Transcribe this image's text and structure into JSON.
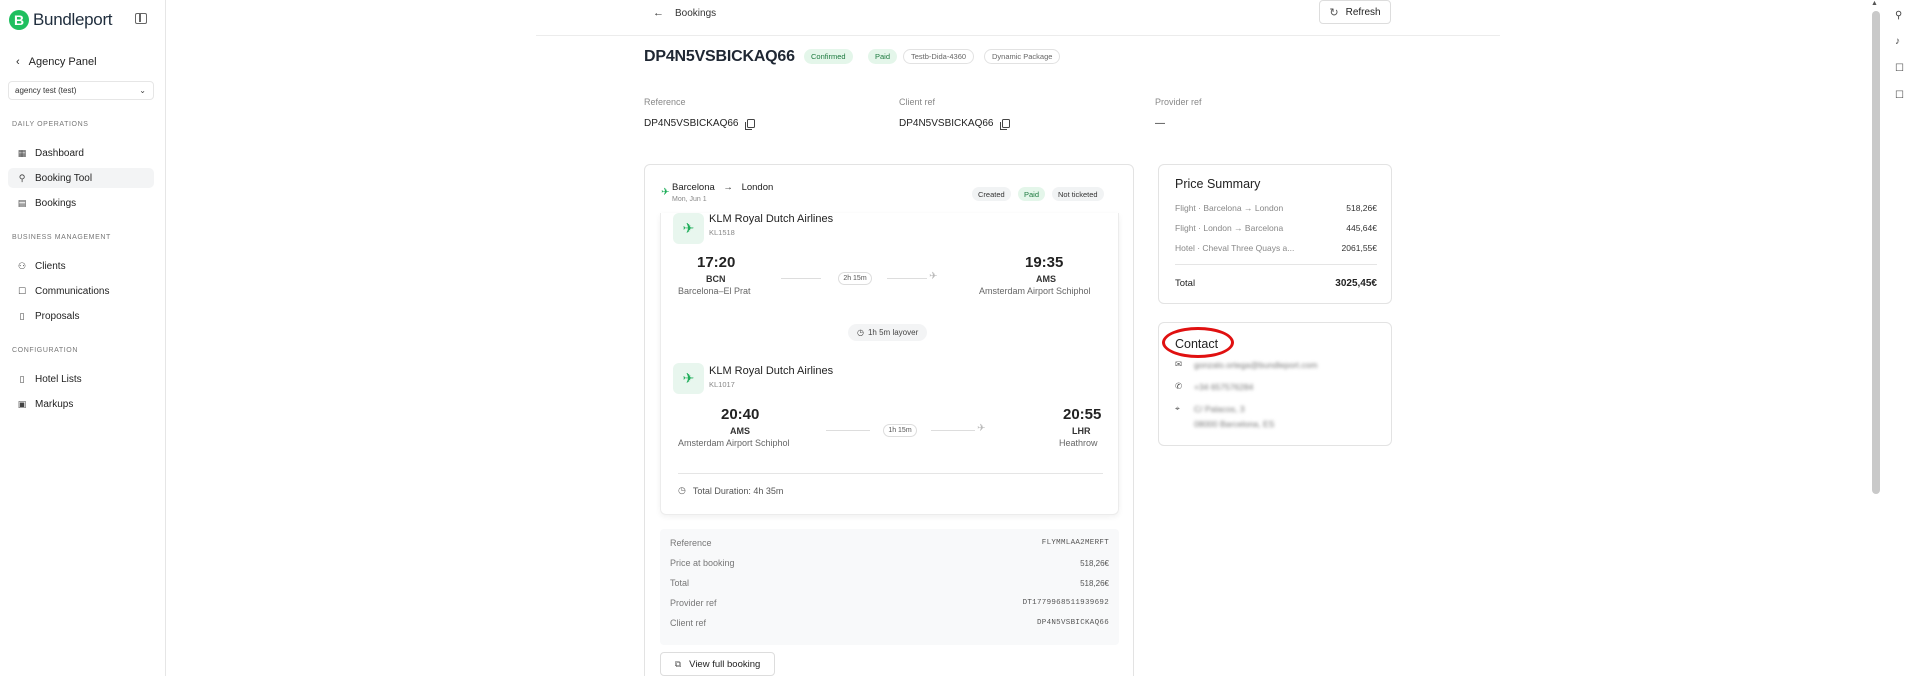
{
  "brand": {
    "name": "Bundleport",
    "mark": "B"
  },
  "sidebar": {
    "panel_label": "Agency Panel",
    "agency_select": "agency test (test)",
    "sections": [
      {
        "title": "DAILY OPERATIONS"
      },
      {
        "title": "BUSINESS MANAGEMENT"
      },
      {
        "title": "CONFIGURATION"
      }
    ],
    "items": [
      {
        "label": "Dashboard",
        "icon": "dashboard-icon"
      },
      {
        "label": "Booking Tool",
        "icon": "search-icon"
      },
      {
        "label": "Bookings",
        "icon": "calendar-icon"
      },
      {
        "label": "Clients",
        "icon": "users-icon"
      },
      {
        "label": "Communications",
        "icon": "message-icon"
      },
      {
        "label": "Proposals",
        "icon": "document-icon"
      },
      {
        "label": "Hotel Lists",
        "icon": "bookmark-icon"
      },
      {
        "label": "Markups",
        "icon": "tag-icon"
      }
    ]
  },
  "topbar": {
    "back_label": "Bookings",
    "refresh_label": "Refresh"
  },
  "booking": {
    "title": "DP4N5VSBICKAQ66",
    "badges": [
      "Confirmed",
      "Paid",
      "Testb-Dida-4360",
      "Dynamic Package"
    ],
    "reference_label": "Reference",
    "reference_value": "DP4N5VSBICKAQ66",
    "client_ref_label": "Client ref",
    "client_ref_value": "DP4N5VSBICKAQ66",
    "provider_ref_label": "Provider ref",
    "provider_ref_value": "—"
  },
  "flight": {
    "from": "Barcelona",
    "arrow": "→",
    "to": "London",
    "date": "Mon, Jun 1",
    "statuses": [
      "Created",
      "Paid",
      "Not ticketed"
    ],
    "segments": [
      {
        "airline": "KLM Royal Dutch Airlines",
        "flight_no": "KL1518",
        "dep_time": "17:20",
        "dep_code": "BCN",
        "dep_airport": "Barcelona–El Prat",
        "duration": "2h 15m",
        "arr_time": "19:35",
        "arr_code": "AMS",
        "arr_airport": "Amsterdam Airport Schiphol"
      },
      {
        "airline": "KLM Royal Dutch Airlines",
        "flight_no": "KL1017",
        "dep_time": "20:40",
        "dep_code": "AMS",
        "dep_airport": "Amsterdam Airport Schiphol",
        "duration": "1h 15m",
        "arr_time": "20:55",
        "arr_code": "LHR",
        "arr_airport": "Heathrow"
      }
    ],
    "layover": "1h 5m layover",
    "total_duration": "Total Duration: 4h 35m",
    "details": [
      {
        "label": "Reference",
        "value": "FLYMMLAA2MERFT"
      },
      {
        "label": "Price at booking",
        "value": "518,26€"
      },
      {
        "label": "Total",
        "value": "518,26€"
      },
      {
        "label": "Provider ref",
        "value": "DT1779968511939692"
      },
      {
        "label": "Client ref",
        "value": "DP4N5VSBICKAQ66"
      }
    ],
    "view_full": "View full booking"
  },
  "price_summary": {
    "title": "Price Summary",
    "rows": [
      {
        "label": "Flight · Barcelona → London",
        "value": "518,26€"
      },
      {
        "label": "Flight · London → Barcelona",
        "value": "445,64€"
      },
      {
        "label": "Hotel · Cheval Three Quays a...",
        "value": "2061,55€"
      }
    ],
    "total_label": "Total",
    "total_value": "3025,45€"
  },
  "contact": {
    "title": "Contact",
    "email": "gonzalo.ortega@bundleport.com",
    "phone": "+34 657576284",
    "address_line1": "C/ Palacos, 3",
    "address_line2": "08000 Barcelona, ES"
  },
  "colors": {
    "accent": "#1fbf5f",
    "annotation": "#e01010"
  }
}
